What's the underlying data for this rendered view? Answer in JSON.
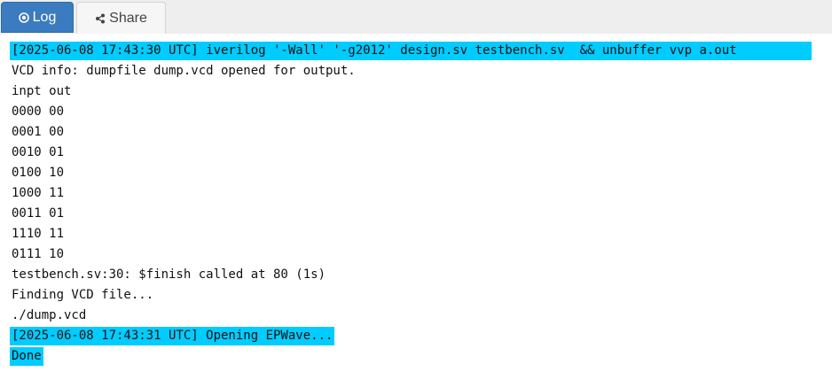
{
  "tabs": {
    "log_label": "Log",
    "share_label": "Share"
  },
  "colors": {
    "tab_active": "#3b7bbf",
    "highlight": "#00ccff"
  },
  "log": {
    "lines": [
      "[2025-06-08 17:43:30 UTC] iverilog '-Wall' '-g2012' design.sv testbench.sv  && unbuffer vvp a.out",
      "VCD info: dumpfile dump.vcd opened for output.",
      "inpt out",
      "0000 00",
      "0001 00",
      "0010 01",
      "0100 10",
      "1000 11",
      "0011 01",
      "1110 11",
      "0111 10",
      "testbench.sv:30: $finish called at 80 (1s)",
      "Finding VCD file...",
      "./dump.vcd",
      "[2025-06-08 17:43:31 UTC] Opening EPWave...",
      "Done"
    ]
  }
}
